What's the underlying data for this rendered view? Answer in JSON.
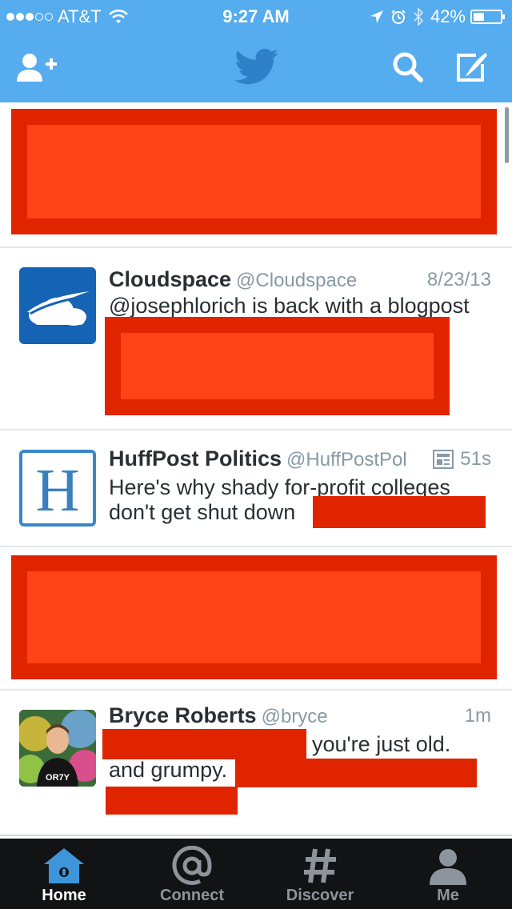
{
  "status_bar": {
    "carrier": "AT&T",
    "time": "9:27 AM",
    "battery": "42%",
    "battery_level": 0.42,
    "signal_bars": 3
  },
  "colors": {
    "brand": "#55acee",
    "redaction": "#e12400",
    "redaction_inner": "#ff4316",
    "tabbar": "#111315"
  },
  "header": {
    "left_icon": "add-user-icon",
    "center_icon": "twitter-bird-logo",
    "search_icon": "search-icon",
    "compose_icon": "compose-icon"
  },
  "tweets": [
    {
      "name": "Cloudspace",
      "handle": "@Cloudspace",
      "time": "8/23/13",
      "lines": [
        "@josephlorich is back with a blogpost"
      ]
    },
    {
      "name": "HuffPost Politics",
      "handle": "@HuffPostPol",
      "time": "51s",
      "lines": [
        "Here's why shady for-profit colleges",
        "don't get shut down"
      ]
    },
    {
      "name": "Bryce Roberts",
      "handle": "@bryce",
      "time": "1m",
      "lines": [
        "you're just old.",
        "and grumpy."
      ],
      "avatar_shirt_text": "OR7Y"
    }
  ],
  "tabs": [
    {
      "label": "Home",
      "icon": "home-icon",
      "active": true
    },
    {
      "label": "Connect",
      "icon": "at-icon",
      "active": false
    },
    {
      "label": "Discover",
      "icon": "hashtag-icon",
      "active": false
    },
    {
      "label": "Me",
      "icon": "person-icon",
      "active": false
    }
  ]
}
